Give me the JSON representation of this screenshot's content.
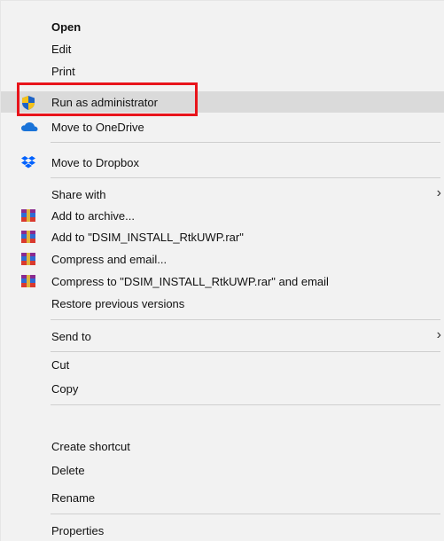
{
  "menu": {
    "items": [
      {
        "label": "Open"
      },
      {
        "label": "Edit"
      },
      {
        "label": "Print"
      },
      {
        "label": "Run as administrator",
        "icon": "uac-shield-icon"
      },
      {
        "label": "Move to OneDrive",
        "icon": "onedrive-cloud-icon"
      },
      {
        "label": "Move to Dropbox",
        "icon": "dropbox-icon"
      },
      {
        "label": "Share with"
      },
      {
        "label": "Add to archive...",
        "icon": "winrar-icon"
      },
      {
        "label": "Add to \"DSIM_INSTALL_RtkUWP.rar\"",
        "icon": "winrar-icon"
      },
      {
        "label": "Compress and email...",
        "icon": "winrar-icon"
      },
      {
        "label": "Compress to \"DSIM_INSTALL_RtkUWP.rar\" and email",
        "icon": "winrar-icon"
      },
      {
        "label": "Restore previous versions"
      },
      {
        "label": "Send to"
      },
      {
        "label": "Cut"
      },
      {
        "label": "Copy"
      },
      {
        "label": "Create shortcut"
      },
      {
        "label": "Delete"
      },
      {
        "label": "Rename"
      },
      {
        "label": "Properties"
      }
    ],
    "submenu_arrow": "›"
  },
  "colors": {
    "menu_bg": "#f2f2f2",
    "hover_bg": "#dadada",
    "highlight_border": "#e8141b",
    "shield_blue": "#1e63c6",
    "shield_yellow": "#f5c21b",
    "onedrive_blue": "#1a73d8",
    "dropbox_blue": "#0061fe"
  }
}
